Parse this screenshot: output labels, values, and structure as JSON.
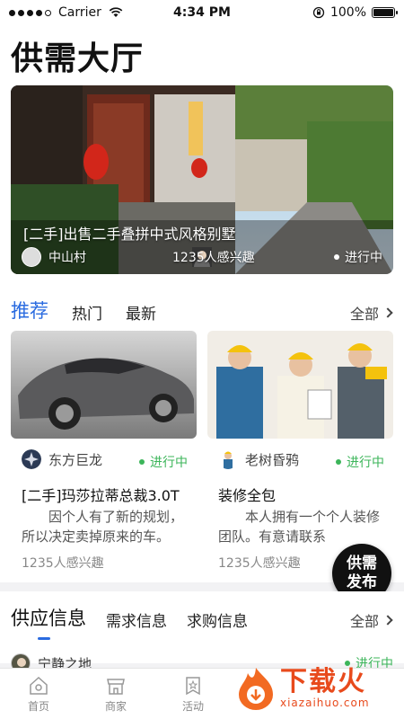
{
  "status_bar": {
    "carrier": "Carrier",
    "time": "4:34 PM",
    "battery": "100%"
  },
  "page_title": "供需大厅",
  "banner": {
    "title": "[二手]出售二手叠拼中式风格别墅",
    "user": "中山村",
    "interest": "1235人感兴趣",
    "status": "进行中"
  },
  "recommend": {
    "tabs": [
      "推荐",
      "热门",
      "最新"
    ],
    "all_label": "全部",
    "cards": [
      {
        "user": "东方巨龙",
        "status": "进行中",
        "title": "[二手]玛莎拉蒂总裁3.0T",
        "desc": "因个人有了新的规划，所以决定卖掉原来的车。",
        "interest": "1235人感兴趣"
      },
      {
        "user": "老树昏鸦",
        "status": "进行中",
        "title": "装修全包",
        "desc": "本人拥有一个个人装修团队。有意请联系",
        "interest": "1235人感兴趣"
      }
    ]
  },
  "publish_button": {
    "line1": "供需",
    "line2": "发布"
  },
  "supply": {
    "tabs": [
      "供应信息",
      "需求信息",
      "求购信息"
    ],
    "all_label": "全部",
    "first_row": {
      "user": "宁静之地",
      "status": "进行中"
    }
  },
  "tabbar": [
    "首页",
    "商家",
    "活动"
  ],
  "watermark": {
    "main": "下载火",
    "sub": "xiazaihuo.com"
  },
  "colors": {
    "accent": "#2a6be0",
    "status_green": "#3cb55a",
    "watermark": "#e84a1c"
  }
}
